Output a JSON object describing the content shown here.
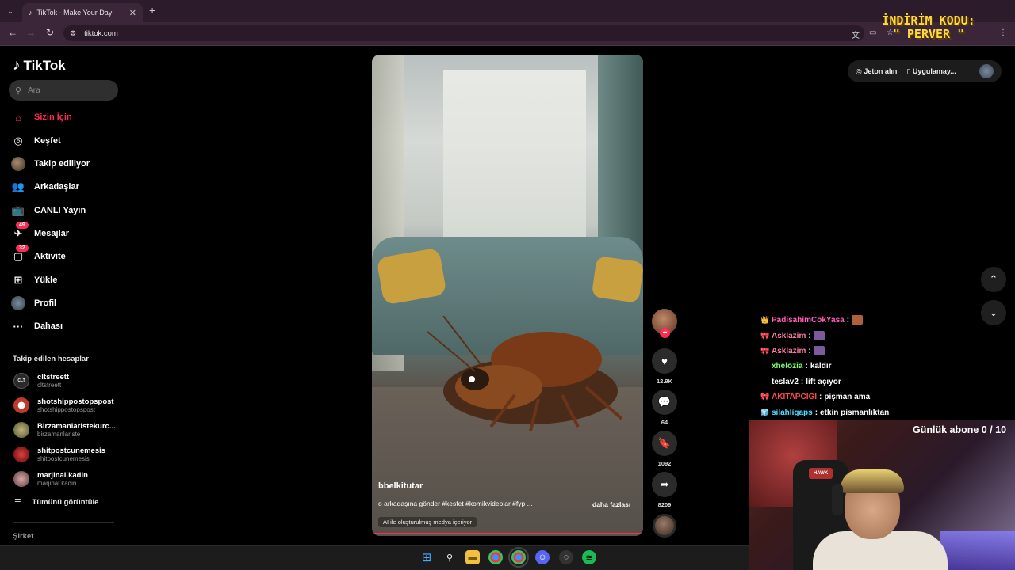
{
  "browser": {
    "tab_title": "TikTok - Make Your Day",
    "url": "tiktok.com"
  },
  "promo": {
    "line1": "İNDİRİM KODU:",
    "line2": "\" PERVER \""
  },
  "sidebar": {
    "logo": "TikTok",
    "search_placeholder": "Ara",
    "nav": [
      {
        "label": "Sizin İçin",
        "icon": "home-icon",
        "active": true
      },
      {
        "label": "Keşfet",
        "icon": "compass-icon"
      },
      {
        "label": "Takip ediliyor",
        "icon": "avatar"
      },
      {
        "label": "Arkadaşlar",
        "icon": "friends-icon"
      },
      {
        "label": "CANLI Yayın",
        "icon": "live-tv-icon"
      },
      {
        "label": "Mesajlar",
        "icon": "paper-plane-icon",
        "badge": "49"
      },
      {
        "label": "Aktivite",
        "icon": "message-bubble-icon",
        "badge": "32"
      },
      {
        "label": "Yükle",
        "icon": "plus-square-icon"
      },
      {
        "label": "Profil",
        "icon": "avatar"
      },
      {
        "label": "Dahası",
        "icon": "more-dots-icon"
      }
    ],
    "following_heading": "Takip edilen hesaplar",
    "accounts": [
      {
        "name": "cltstreett",
        "handle": "cltstreett",
        "color": "#2a2a2a"
      },
      {
        "name": "shotshippostopspost",
        "handle": "shotshippostopspost",
        "color": "#c0392b"
      },
      {
        "name": "Birzamanlaristekurc...",
        "handle": "birzamanlariste",
        "color": "#6a7a3a"
      },
      {
        "name": "shitpostcunemesis",
        "handle": "shitpostcunemesis",
        "color": "#8a1a1a"
      },
      {
        "name": "marjinal.kadin",
        "handle": "marjinal.kadin",
        "color": "#8a5a5a"
      }
    ],
    "see_all": "Tümünü görüntüle",
    "company": "Şirket"
  },
  "video": {
    "username": "bbelkitutar",
    "caption": "o arkadaşına gönder #kesfet #komikvideolar #fyp ...",
    "more": "daha fazlası",
    "ai_label": "AI ile oluşturulmuş medya içeriyor"
  },
  "actions": {
    "likes": "12.9K",
    "comments": "64",
    "saves": "1092",
    "shares": "8209"
  },
  "topright": {
    "coins": "Jeton alın",
    "app": "Uygulamay..."
  },
  "chat": [
    {
      "user": "PadisahimCokYasa",
      "msg": "",
      "color": "#ff5fb8",
      "badge": "👑",
      "emote": "#b06040"
    },
    {
      "user": "Asklazim",
      "msg": "",
      "color": "#ff7aa8",
      "badge": "🎀",
      "emote": "#7a5a9a"
    },
    {
      "user": "Asklazim",
      "msg": "",
      "color": "#ff7aa8",
      "badge": "🎀",
      "emote": "#7a5a9a"
    },
    {
      "user": "xhelozia",
      "msg": "kaldır",
      "color": "#7cff6a",
      "badge": ""
    },
    {
      "user": "teslav2",
      "msg": "lift açıyor",
      "color": "#ffffff",
      "badge": ""
    },
    {
      "user": "AKITAPCIGI",
      "msg": "pişman ama",
      "color": "#ff4a4a",
      "badge": "🎀"
    },
    {
      "user": "silahligaps",
      "msg": "etkin pismanlıktan",
      "color": "#4ae0ff",
      "badge": "🧊"
    }
  ],
  "subgoal": "Günlük abone 0 / 10",
  "webcam": {
    "chair_logo": "HAWK"
  }
}
